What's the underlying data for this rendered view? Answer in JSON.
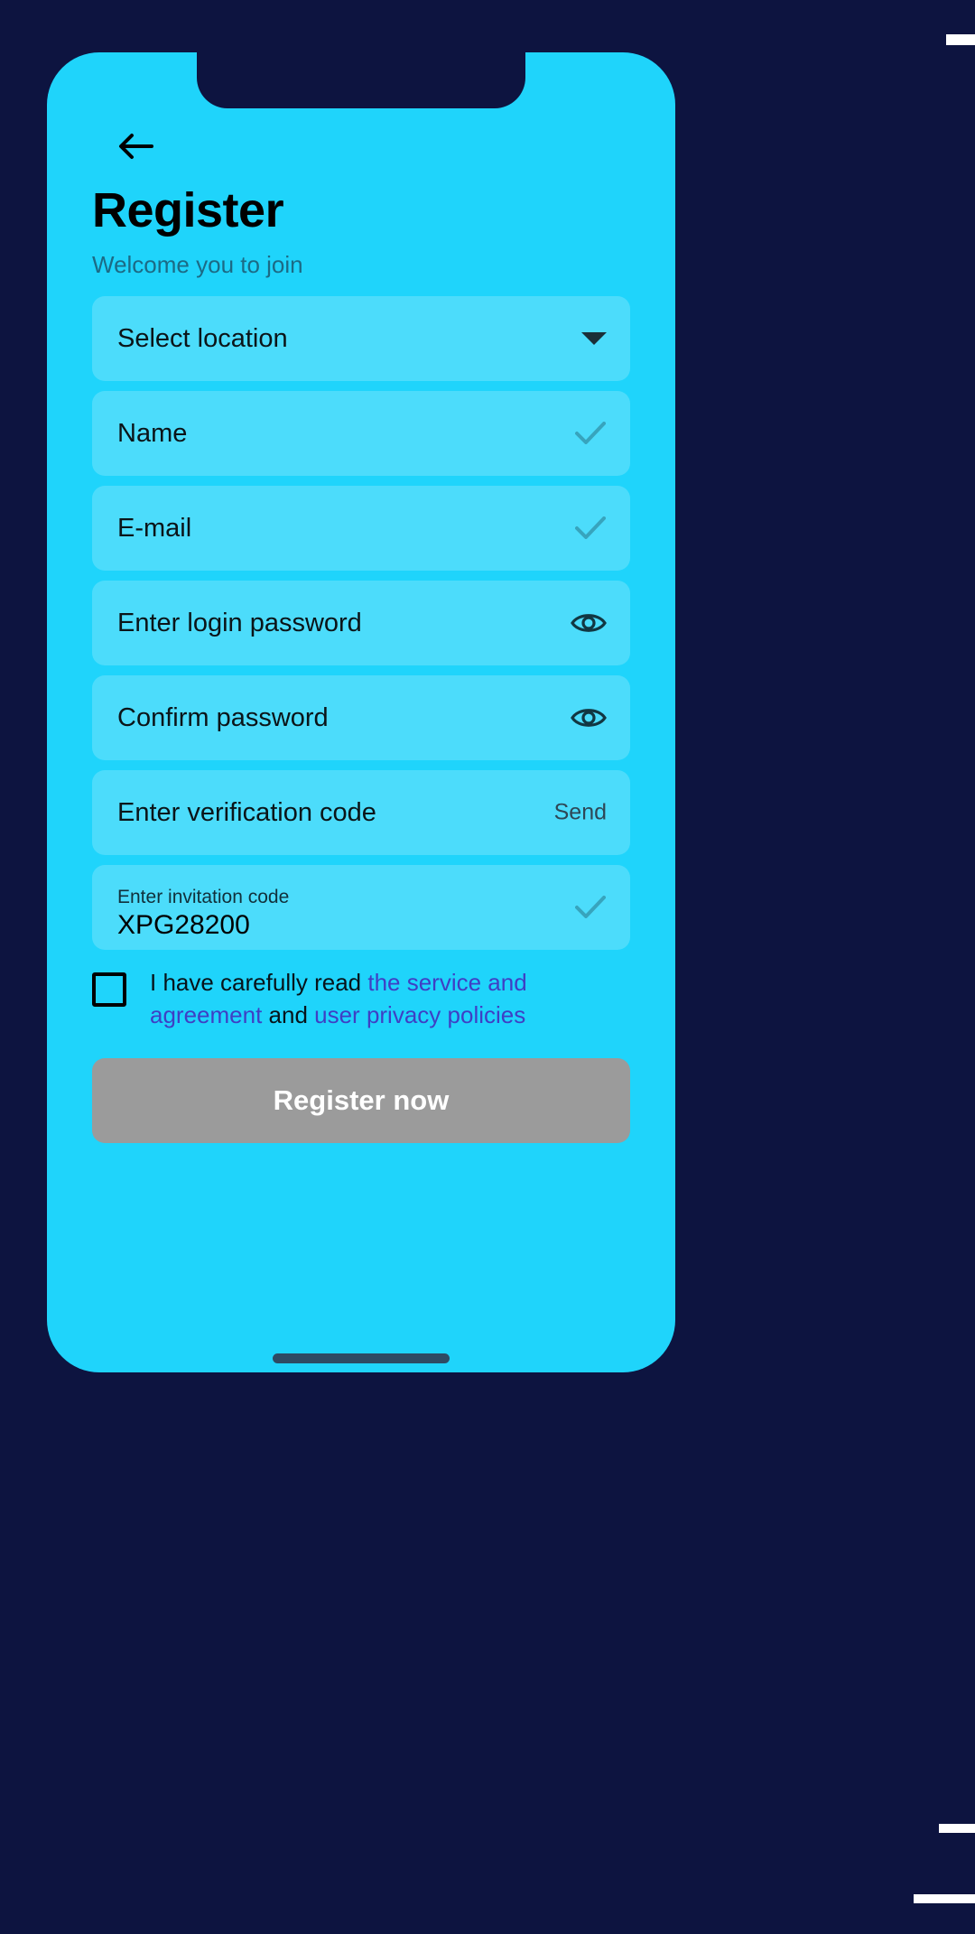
{
  "theme": {
    "page_background": "#0D1440",
    "screen_background": "#1FD4FB",
    "field_background": "#4CDCFB",
    "accent_link": "#3F3FC4",
    "submit_disabled": "#9B9B9B",
    "heading_color": "#000000",
    "subtitle_color": "#1C6A85"
  },
  "header": {
    "back_icon": "arrow-left-icon",
    "title": "Register",
    "subtitle": "Welcome you to join"
  },
  "form": {
    "fields": [
      {
        "name": "location",
        "label": "Select location",
        "placeholder": "Select location",
        "value": "",
        "trailing": "chevron-down-icon"
      },
      {
        "name": "name",
        "label": "Name",
        "placeholder": "Name",
        "value": "",
        "trailing": "check-icon"
      },
      {
        "name": "email",
        "label": "E-mail",
        "placeholder": "E-mail",
        "value": "",
        "trailing": "check-icon"
      },
      {
        "name": "login-password",
        "label": "Enter login password",
        "placeholder": "Enter login password",
        "value": "",
        "trailing": "eye-icon"
      },
      {
        "name": "confirm-password",
        "label": "Confirm password",
        "placeholder": "Confirm password",
        "value": "",
        "trailing": "eye-icon"
      },
      {
        "name": "verification-code",
        "label": "Enter verification code",
        "placeholder": "Enter verification code",
        "value": "",
        "trailing": "send-link",
        "send_label": "Send"
      },
      {
        "name": "invitation-code",
        "label": "Enter invitation code",
        "placeholder": "Enter invitation code",
        "value": "XPG28200",
        "trailing": "check-icon"
      }
    ]
  },
  "agreement": {
    "checked": false,
    "text_part_1": "I have carefully read ",
    "link_1": "the service and agreement",
    "text_part_2": " and ",
    "link_2": "user privacy policies"
  },
  "submit": {
    "label": "Register now",
    "enabled": false
  }
}
